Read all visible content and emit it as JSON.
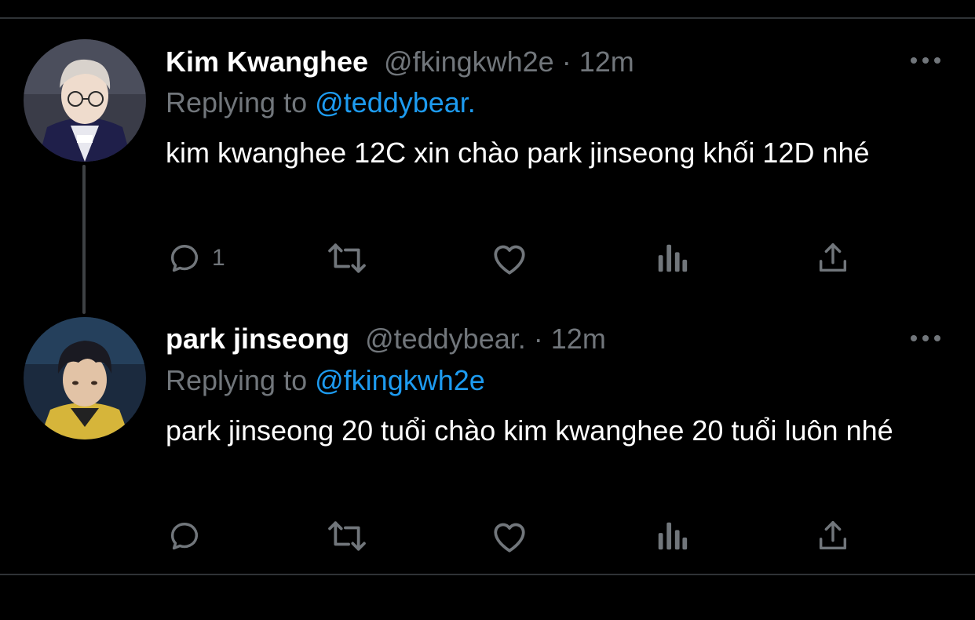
{
  "tweets": [
    {
      "name": "Kim Kwanghee",
      "handle": "@fkingkwh2e",
      "separator": "·",
      "time": "12m",
      "replying_label": "Replying to",
      "replying_to": "@teddybear.",
      "text": "kim kwanghee 12C xin chào park jinseong khối 12D nhé",
      "reply_count": "1",
      "avatar": "avatar-kim-kwanghee"
    },
    {
      "name": "park jinseong",
      "handle": "@teddybear.",
      "separator": "·",
      "time": "12m",
      "replying_label": "Replying to",
      "replying_to": "@fkingkwh2e",
      "text": "park jinseong 20 tuổi chào kim kwanghee 20 tuổi luôn nhé",
      "reply_count": "",
      "avatar": "avatar-park-jinseong"
    }
  ],
  "colors": {
    "background": "#000000",
    "primary_text": "#ffffff",
    "secondary_text": "#71767b",
    "accent": "#1d9bf0",
    "divider": "#2f3336"
  },
  "icons": [
    "reply-icon",
    "retweet-icon",
    "like-icon",
    "views-icon",
    "share-icon",
    "more-icon"
  ]
}
